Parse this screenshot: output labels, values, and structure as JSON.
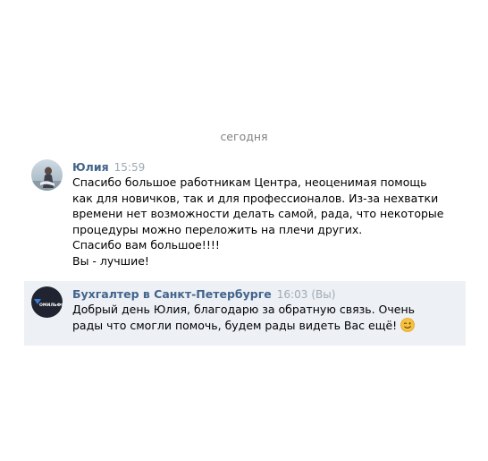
{
  "date_separator": "сегодня",
  "messages": [
    {
      "author": "Юлия",
      "time": "15:59",
      "lines": [
        "Спасибо большое работникам Центра, неоценимая помощь",
        "как для новичков, так и для профессионалов. Из-за нехватки",
        "времени нет возможности делать самой, рада, что некоторые",
        "процедуры можно переложить на плечи других.",
        "Спасибо вам большое!!!!",
        "Вы - лучшие!"
      ],
      "avatar_icon": "user-photo-avatar"
    },
    {
      "author": "Бухгалтер в Санкт-Петербурге",
      "time": "16:03",
      "you_label": "(Вы)",
      "lines": [
        "Добрый день Юлия, благодарю за обратную связь. Очень",
        "рады что смогли помочь, будем рады видеть Вас ещё!"
      ],
      "emoji": "winking-face-emoji",
      "avatar_icon": "company-logo-avatar",
      "avatar_logo_text": "ОМИЛЬФО",
      "highlight_color": "#edf0f5"
    }
  ],
  "colors": {
    "author": "#42648b",
    "time": "#9eaab5",
    "date_separator": "#828282"
  }
}
